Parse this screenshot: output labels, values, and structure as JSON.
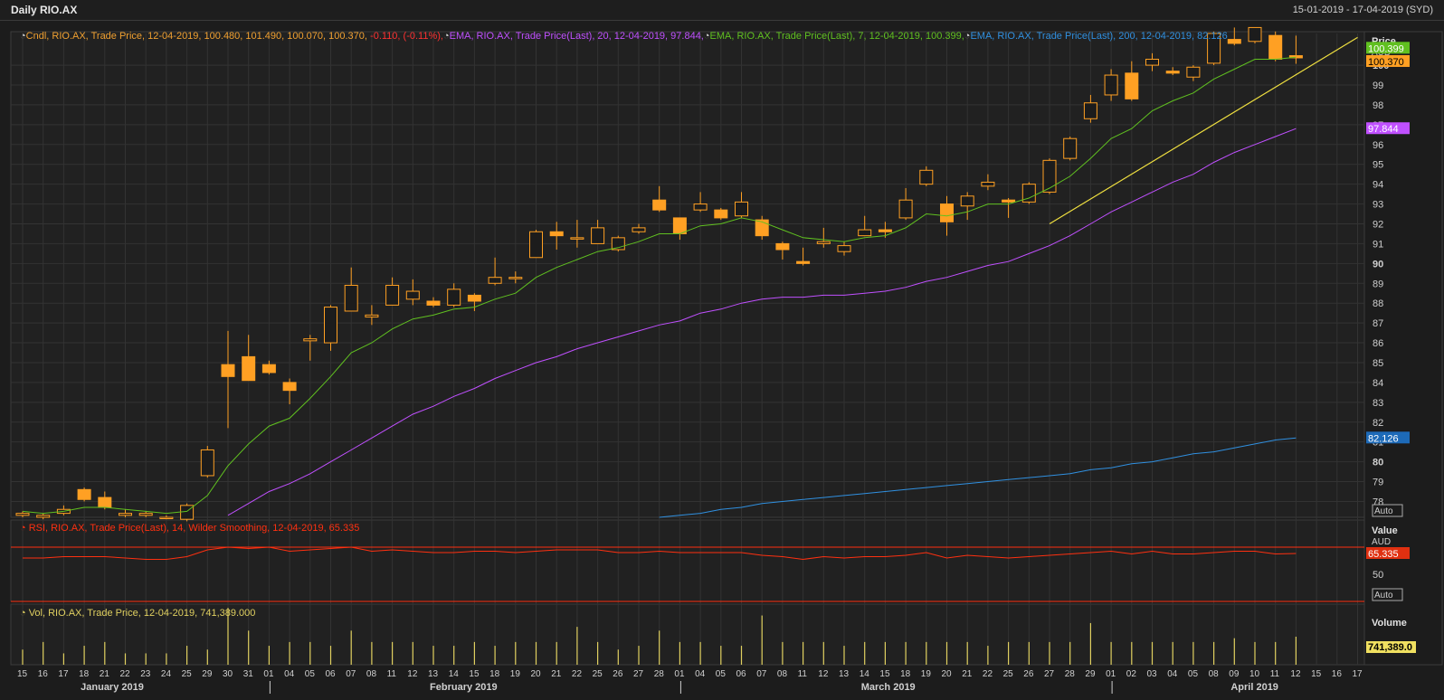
{
  "title": "Daily RIO.AX",
  "date_range": "15-01-2019 - 17-04-2019 (SYD)",
  "legend": {
    "candle": {
      "text": "Cndl, RIO.AX, Trade Price, 12-04-2019, 100.480, 101.490, 100.070, 100.370,",
      "change": " -0.110, (-0.11%),",
      "color": "#f0a030",
      "change_color": "#ff3030"
    },
    "ema20": {
      "text": "EMA, RIO.AX, Trade Price(Last), 20, 12-04-2019, 97.844,",
      "color": "#c050ff"
    },
    "ema7": {
      "text": "EMA, RIO.AX, Trade Price(Last), 7, 12-04-2019, 100.399,",
      "color": "#60c020"
    },
    "ema200": {
      "text": "EMA, RIO.AX, Trade Price(Last), 200, 12-04-2019, 82.126",
      "color": "#3090e0"
    },
    "rsi": {
      "text": "RSI, RIO.AX, Trade Price(Last), 14, Wilder Smoothing, 12-04-2019, 65.335",
      "color": "#ff3010"
    },
    "vol": {
      "text": "Vol, RIO.AX, Trade Price, 12-04-2019, 741,389.000",
      "color": "#e0d060"
    }
  },
  "axes": {
    "price_title": "Price",
    "price_unit": "AUD",
    "value_title": "Value",
    "value_unit": "AUD",
    "volume_title": "Volume",
    "auto_label": "Auto",
    "price_ticks": [
      78,
      79,
      80,
      81,
      82,
      83,
      84,
      85,
      86,
      87,
      88,
      89,
      90,
      91,
      92,
      93,
      94,
      95,
      96,
      97,
      98,
      99,
      100
    ],
    "rsi_ticks": [
      50
    ]
  },
  "value_badges": {
    "ema7": "100.399",
    "close": "100.370",
    "ema20": "97.844",
    "ema200": "82.126",
    "rsi": "65.335",
    "volume": "741,389.0"
  },
  "x_axis": {
    "day_labels": [
      "15",
      "16",
      "17",
      "18",
      "21",
      "22",
      "23",
      "24",
      "25",
      "29",
      "30",
      "31",
      "01",
      "04",
      "05",
      "06",
      "07",
      "08",
      "11",
      "12",
      "13",
      "14",
      "15",
      "18",
      "19",
      "20",
      "21",
      "22",
      "25",
      "26",
      "27",
      "28",
      "01",
      "04",
      "05",
      "06",
      "07",
      "08",
      "11",
      "12",
      "13",
      "14",
      "15",
      "18",
      "19",
      "20",
      "21",
      "22",
      "25",
      "26",
      "27",
      "28",
      "29",
      "01",
      "02",
      "03",
      "04",
      "05",
      "08",
      "09",
      "10",
      "11",
      "12",
      "15",
      "16",
      "17"
    ],
    "months": [
      {
        "label": "January 2019",
        "at": 4.5
      },
      {
        "label": "February 2019",
        "at": 21.5
      },
      {
        "label": "March 2019",
        "at": 42.5
      },
      {
        "label": "April 2019",
        "at": 60.5
      }
    ],
    "month_separators": [
      12,
      32,
      53
    ]
  },
  "chart_data": {
    "type": "candlestick",
    "title": "Daily RIO.AX",
    "ylabel": "Price",
    "ylim": [
      77.2,
      101.6
    ],
    "dates": [
      "15",
      "16",
      "17",
      "18",
      "21",
      "22",
      "23",
      "24",
      "25",
      "29",
      "30",
      "31",
      "01",
      "04",
      "05",
      "06",
      "07",
      "08",
      "11",
      "12",
      "13",
      "14",
      "15",
      "18",
      "19",
      "20",
      "21",
      "22",
      "25",
      "26",
      "27",
      "28",
      "01",
      "04",
      "05",
      "06",
      "07",
      "08",
      "11",
      "12",
      "13",
      "14",
      "15",
      "18",
      "19",
      "20",
      "21",
      "22",
      "25",
      "26",
      "27",
      "28",
      "29",
      "01",
      "02",
      "03",
      "04",
      "05",
      "08",
      "09",
      "10",
      "11",
      "12"
    ],
    "ohlc": [
      [
        77.3,
        77.5,
        77.2,
        77.4
      ],
      [
        77.2,
        77.4,
        77.1,
        77.3
      ],
      [
        77.4,
        77.8,
        77.3,
        77.6
      ],
      [
        78.6,
        78.7,
        78.0,
        78.1
      ],
      [
        78.2,
        78.5,
        77.6,
        77.7
      ],
      [
        77.3,
        77.6,
        77.2,
        77.4
      ],
      [
        77.3,
        77.5,
        77.2,
        77.4
      ],
      [
        77.2,
        77.3,
        77.1,
        77.2
      ],
      [
        77.1,
        77.9,
        77.0,
        77.8
      ],
      [
        79.3,
        80.8,
        79.2,
        80.6
      ],
      [
        84.9,
        86.6,
        81.7,
        84.3
      ],
      [
        85.3,
        86.4,
        84.1,
        84.1
      ],
      [
        84.9,
        85.1,
        84.4,
        84.5
      ],
      [
        84.0,
        84.2,
        82.9,
        83.6
      ],
      [
        86.1,
        86.4,
        85.1,
        86.2
      ],
      [
        86.0,
        87.9,
        85.6,
        87.8
      ],
      [
        87.6,
        89.8,
        87.6,
        88.9
      ],
      [
        87.3,
        87.9,
        86.9,
        87.4
      ],
      [
        87.9,
        89.3,
        87.9,
        88.9
      ],
      [
        88.2,
        89.2,
        87.9,
        88.6
      ],
      [
        88.1,
        88.3,
        87.8,
        87.9
      ],
      [
        87.9,
        89.0,
        87.8,
        88.7
      ],
      [
        88.4,
        88.5,
        87.6,
        88.1
      ],
      [
        89.0,
        90.3,
        88.9,
        89.3
      ],
      [
        89.3,
        89.6,
        89.0,
        89.3
      ],
      [
        90.3,
        91.7,
        90.3,
        91.6
      ],
      [
        91.6,
        92.1,
        90.7,
        91.4
      ],
      [
        91.3,
        92.2,
        90.8,
        91.3
      ],
      [
        91.0,
        92.2,
        91.0,
        91.8
      ],
      [
        90.7,
        91.4,
        90.6,
        91.3
      ],
      [
        91.6,
        92.0,
        91.5,
        91.8
      ],
      [
        93.2,
        93.9,
        92.6,
        92.7
      ],
      [
        92.3,
        92.3,
        91.2,
        91.5
      ],
      [
        92.7,
        93.6,
        92.6,
        93.0
      ],
      [
        92.7,
        92.8,
        92.2,
        92.3
      ],
      [
        92.4,
        93.6,
        92.3,
        93.1
      ],
      [
        92.2,
        92.4,
        91.2,
        91.4
      ],
      [
        91.0,
        91.1,
        90.2,
        90.7
      ],
      [
        90.1,
        90.8,
        89.9,
        90.0
      ],
      [
        91.0,
        91.8,
        90.8,
        91.1
      ],
      [
        90.6,
        91.1,
        90.4,
        90.9
      ],
      [
        91.4,
        92.4,
        91.4,
        91.7
      ],
      [
        91.7,
        92.1,
        91.3,
        91.6
      ],
      [
        92.3,
        93.8,
        92.2,
        93.2
      ],
      [
        94.0,
        94.9,
        93.9,
        94.7
      ],
      [
        93.0,
        93.4,
        91.4,
        92.1
      ],
      [
        92.9,
        93.6,
        92.2,
        93.4
      ],
      [
        93.9,
        94.5,
        93.7,
        94.1
      ],
      [
        93.2,
        93.3,
        92.3,
        93.1
      ],
      [
        93.1,
        94.1,
        93.0,
        94.0
      ],
      [
        93.6,
        95.3,
        93.5,
        95.2
      ],
      [
        95.3,
        96.4,
        95.2,
        96.3
      ],
      [
        97.3,
        98.5,
        97.1,
        98.1
      ],
      [
        98.5,
        99.8,
        98.2,
        99.5
      ],
      [
        99.6,
        100.2,
        98.2,
        98.3
      ],
      [
        100.0,
        100.6,
        99.7,
        100.3
      ],
      [
        99.7,
        99.9,
        99.5,
        99.6
      ],
      [
        99.4,
        100.0,
        99.2,
        99.9
      ],
      [
        100.1,
        101.7,
        100.0,
        101.6
      ],
      [
        101.3,
        101.9,
        101.0,
        101.1
      ],
      [
        101.2,
        101.9,
        101.1,
        101.9
      ],
      [
        101.5,
        101.7,
        100.2,
        100.3
      ],
      [
        100.48,
        101.49,
        100.07,
        100.37
      ]
    ],
    "series": [
      {
        "name": "EMA 7",
        "values": [
          77.5,
          77.4,
          77.5,
          77.7,
          77.7,
          77.6,
          77.5,
          77.4,
          77.5,
          78.3,
          79.8,
          80.9,
          81.8,
          82.2,
          83.2,
          84.3,
          85.5,
          86.0,
          86.7,
          87.2,
          87.4,
          87.7,
          87.8,
          88.2,
          88.5,
          89.3,
          89.8,
          90.2,
          90.6,
          90.8,
          91.1,
          91.5,
          91.5,
          91.9,
          92.0,
          92.3,
          92.1,
          91.7,
          91.3,
          91.2,
          91.1,
          91.3,
          91.4,
          91.8,
          92.5,
          92.4,
          92.6,
          93.0,
          93.0,
          93.3,
          93.8,
          94.4,
          95.3,
          96.3,
          96.8,
          97.7,
          98.2,
          98.6,
          99.3,
          99.8,
          100.3,
          100.3,
          100.4
        ]
      },
      {
        "name": "EMA 20",
        "values": [
          null,
          null,
          null,
          null,
          null,
          null,
          null,
          null,
          null,
          null,
          77.3,
          77.9,
          78.5,
          78.9,
          79.4,
          80.0,
          80.6,
          81.2,
          81.8,
          82.4,
          82.8,
          83.3,
          83.7,
          84.2,
          84.6,
          85.0,
          85.3,
          85.7,
          86.0,
          86.3,
          86.6,
          86.9,
          87.1,
          87.5,
          87.7,
          88.0,
          88.2,
          88.3,
          88.3,
          88.4,
          88.4,
          88.5,
          88.6,
          88.8,
          89.1,
          89.3,
          89.6,
          89.9,
          90.1,
          90.5,
          90.9,
          91.4,
          92.0,
          92.6,
          93.1,
          93.6,
          94.1,
          94.5,
          95.1,
          95.6,
          96.0,
          96.4,
          96.8
        ]
      },
      {
        "name": "EMA 200",
        "values": [
          null,
          null,
          null,
          null,
          null,
          null,
          null,
          null,
          null,
          null,
          null,
          null,
          null,
          null,
          null,
          null,
          null,
          null,
          null,
          null,
          null,
          null,
          null,
          null,
          null,
          null,
          null,
          null,
          null,
          null,
          null,
          77.2,
          77.3,
          77.4,
          77.6,
          77.7,
          77.9,
          78.0,
          78.1,
          78.2,
          78.3,
          78.4,
          78.5,
          78.6,
          78.7,
          78.8,
          78.9,
          79.0,
          79.1,
          79.2,
          79.3,
          79.4,
          79.6,
          79.7,
          79.9,
          80.0,
          80.2,
          80.4,
          80.5,
          80.7,
          80.9,
          81.1,
          81.2
        ]
      }
    ],
    "trendline": {
      "from": [
        50,
        92.0
      ],
      "to": [
        65,
        101.4
      ]
    },
    "rsi": {
      "name": "RSI 14",
      "values": [
        62,
        62,
        63,
        63,
        63,
        62,
        61,
        61,
        63,
        68,
        70,
        69,
        70,
        67,
        68,
        69,
        70,
        67,
        68,
        67,
        66,
        66,
        67,
        67,
        66,
        67,
        68,
        68,
        68,
        66,
        66,
        67,
        66,
        66,
        66,
        66,
        64,
        63,
        61,
        63,
        62,
        63,
        63,
        64,
        66,
        62,
        64,
        63,
        62,
        63,
        64,
        65,
        66,
        67,
        65,
        67,
        65,
        65,
        66,
        67,
        67,
        65,
        65.335
      ],
      "ylim": [
        30,
        90
      ],
      "levels": [
        70,
        30
      ]
    },
    "volume": {
      "name": "Volume",
      "values": [
        0.4,
        0.6,
        0.3,
        0.5,
        0.6,
        0.3,
        0.3,
        0.3,
        0.5,
        0.4,
        1.5,
        0.9,
        0.5,
        0.6,
        0.6,
        0.5,
        0.9,
        0.6,
        0.6,
        0.6,
        0.5,
        0.5,
        0.6,
        0.5,
        0.6,
        0.6,
        0.6,
        1.0,
        0.6,
        0.4,
        0.5,
        0.9,
        0.6,
        0.6,
        0.5,
        0.5,
        1.3,
        0.6,
        0.6,
        0.6,
        0.5,
        0.6,
        0.6,
        0.6,
        0.6,
        0.6,
        0.6,
        0.5,
        0.6,
        0.6,
        0.6,
        0.6,
        1.1,
        0.6,
        0.6,
        0.6,
        0.6,
        0.6,
        0.6,
        0.7,
        0.6,
        0.6,
        0.74
      ],
      "ylim": [
        0,
        1.6
      ]
    }
  },
  "colors": {
    "up_fill": "#1c1c1c",
    "down_fill": "#ffa023",
    "candle": "#ffa023",
    "grid": "#333333",
    "trend": "#f0e040",
    "ema7": "#60c020",
    "ema20": "#c050ff",
    "ema200": "#3090e0",
    "rsi": "#ff3010",
    "volume": "#e0d060"
  }
}
